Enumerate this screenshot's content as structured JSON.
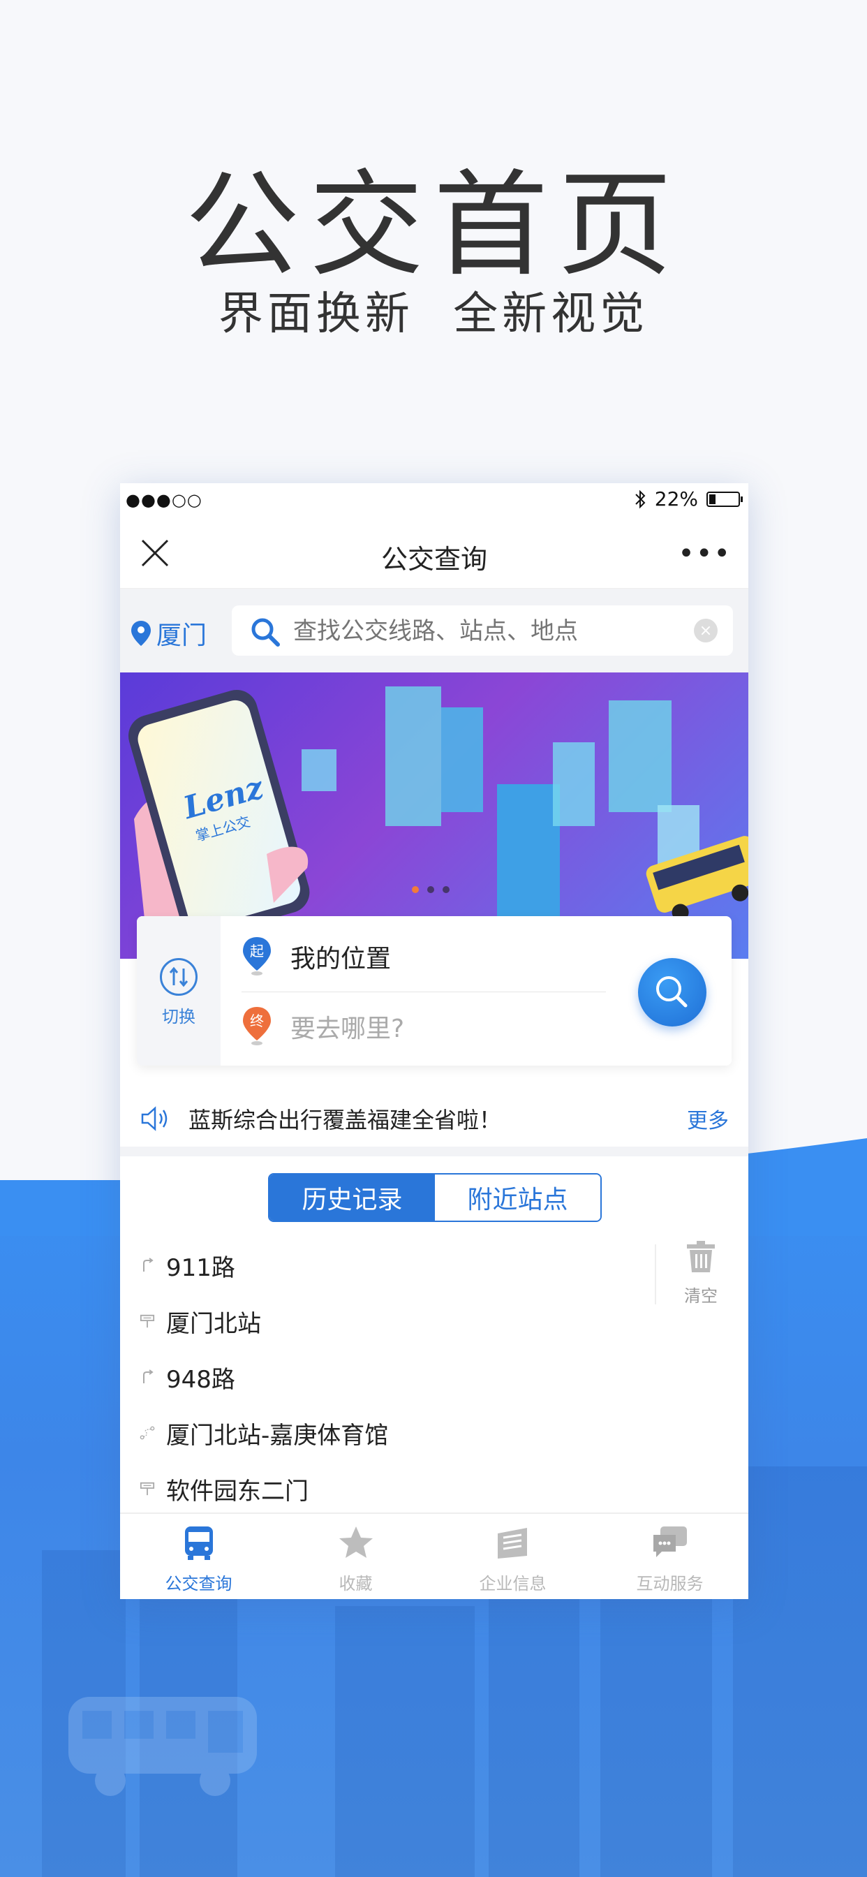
{
  "hero": {
    "title": "公交首页",
    "subtitle": "界面换新  全新视觉"
  },
  "status": {
    "signal": "●●●○○",
    "battery": "22%",
    "battery_level": 0.22
  },
  "nav": {
    "title": "公交查询"
  },
  "search": {
    "city": "厦门",
    "placeholder": "查找公交线路、站点、地点"
  },
  "banner": {
    "logo_text": "Lenz",
    "logo_sub": "掌上公交"
  },
  "route": {
    "swap_label": "切换",
    "start_badge": "起",
    "start_text": "我的位置",
    "end_badge": "终",
    "end_text": "要去哪里?"
  },
  "notice": {
    "text": "蓝斯综合出行覆盖福建全省啦！",
    "more": "更多"
  },
  "tabs": {
    "history": "历史记录",
    "nearby": "附近站点"
  },
  "history": [
    {
      "type": "line-icon",
      "text": "911路"
    },
    {
      "type": "stop-icon",
      "text": "厦门北站"
    },
    {
      "type": "line-icon",
      "text": "948路"
    },
    {
      "type": "route-icon",
      "text": "厦门北站-嘉庚体育馆"
    },
    {
      "type": "stop-icon",
      "text": "软件园东二门"
    }
  ],
  "clear_label": "清空",
  "tabbar": [
    {
      "label": "公交查询",
      "active": true
    },
    {
      "label": "收藏",
      "active": false
    },
    {
      "label": "企业信息",
      "active": false
    },
    {
      "label": "互动服务",
      "active": false
    }
  ],
  "colors": {
    "accent": "#2a76d9",
    "background_blue": "#3a8ff2",
    "inactive_gray": "#b8b8b8"
  }
}
